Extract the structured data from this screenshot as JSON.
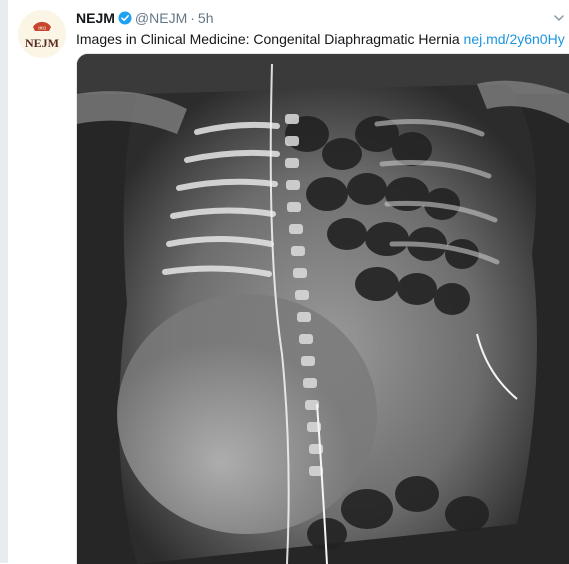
{
  "tweet": {
    "display_name": "NEJM",
    "handle": "@NEJM",
    "separator": "·",
    "time": "5h",
    "text": "Images in Clinical Medicine: Congenital Diaphragmatic Hernia",
    "link": "nej.md/2y6n0Hy",
    "avatar": {
      "wordmark": "NEJM",
      "seal_text": "1812"
    },
    "icons": {
      "verified": "verified-badge-icon",
      "menu": "chevron-down-icon"
    },
    "media": {
      "kind": "radiograph"
    }
  },
  "colors": {
    "name": "#14171a",
    "meta": "#657786",
    "link": "#1b95e0",
    "verified": "#1da1f2",
    "brand_red": "#c8432b",
    "rail": "#e6ecf0"
  }
}
